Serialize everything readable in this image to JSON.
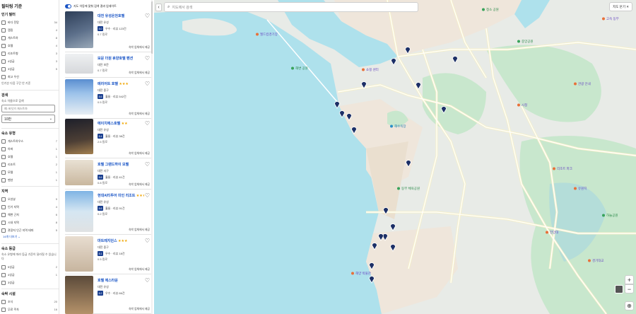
{
  "filters": {
    "title": "필터링 기준",
    "popular": {
      "heading": "인기 필터",
      "items": [
        {
          "label": "바다 전망",
          "count": "34"
        },
        {
          "label": "캠핑",
          "count": "4"
        },
        {
          "label": "게스트하",
          "count": "8"
        },
        {
          "label": "호텔",
          "count": "4"
        },
        {
          "label": "리조트형",
          "count": "3"
        },
        {
          "label": "4성급",
          "count": "3"
        },
        {
          "label": "3성급",
          "count": "5"
        },
        {
          "label": "최고 우선",
          "count": ""
        }
      ],
      "note": "인기순 다음 구간 안 기준"
    },
    "property_name": {
      "heading": "검색",
      "sub": "숙소 이름으로 검색",
      "placeholder": "예: 바닷가 게스트하"
    },
    "sort": {
      "value": "10만",
      "arrow": "⌄"
    },
    "type": {
      "heading": "숙소 유형",
      "items": [
        {
          "label": "게스트하우스",
          "count": "7"
        },
        {
          "label": "아파",
          "count": "1"
        },
        {
          "label": "호텔",
          "count": "1"
        },
        {
          "label": "리조트",
          "count": "2"
        },
        {
          "label": "모텔",
          "count": "1"
        },
        {
          "label": "펜션",
          "count": "1"
        }
      ]
    },
    "area": {
      "heading": "지역",
      "items": [
        {
          "label": "오션뷰",
          "count": "9"
        },
        {
          "label": "인기 지역",
          "count": "4"
        },
        {
          "label": "해변 근처",
          "count": "6"
        },
        {
          "label": "시내 지역",
          "count": "8"
        },
        {
          "label": "관광지 인근 지역 테마",
          "count": "5"
        }
      ],
      "more": "14개 더보기 ⌄"
    },
    "rating": {
      "heading": "숙소 등급",
      "note": "숙소 유형에 따라 등급 기준이 달라질 수 있습니다",
      "items": [
        {
          "label": "5성급",
          "count": "2"
        },
        {
          "label": "4성급",
          "count": "1"
        },
        {
          "label": "3성급",
          "count": ""
        }
      ]
    },
    "amenities": {
      "heading": "숙박 시설",
      "items": [
        {
          "label": "조식",
          "count": "20"
        },
        {
          "label": "무료 주차",
          "count": "16"
        },
        {
          "label": "공용 주방",
          "count": "8"
        }
      ]
    }
  },
  "results": {
    "toggle_label": "지도 이동에 맞춰 검색 결과 업데이트",
    "cards": [
      {
        "name": "대전 유성온천호텔",
        "stars": "",
        "area": "대전 유성",
        "score": "8.0",
        "score_label": "우수 · 리뷰 123건",
        "dist": "0.7 킬로",
        "cta": "숙박 업체에서 제공"
      },
      {
        "name": "보문 더원 휴양호텔 펜션",
        "stars": "",
        "area": "대전 보문",
        "score": "",
        "score_label": "",
        "dist": "0.7 킬로",
        "cta": "숙박 업체에서 제공"
      },
      {
        "name": "메리어트 호텔",
        "stars": "★★★",
        "area": "대전 중구",
        "score": "8.6",
        "score_label": "훌륭 · 리뷰 542건",
        "dist": "0.5 킬로",
        "cta": "숙박 업체에서 제공"
      },
      {
        "name": "에이치에스호텔",
        "stars": "★★",
        "area": "대전 유성",
        "score": "8.4",
        "score_label": "훌륭 · 리뷰 38건",
        "dist": "2.6 킬로",
        "cta": "숙박 업체에서 제공"
      },
      {
        "name": "호텔 그랜드하이 모텔",
        "stars": "",
        "area": "대전 서구",
        "score": "8.6",
        "score_label": "훌륭 · 리뷰 41건",
        "dist": "0.8 킬로",
        "cta": "숙박 업체에서 제공"
      },
      {
        "name": "현대씨티투어 미인 리조트",
        "stars": "★★★",
        "area": "대전 유성",
        "score": "8.6",
        "score_label": "훌륭 · 리뷰 91건",
        "dist": "0.2 킬로",
        "cta": "숙박 업체에서 제공"
      },
      {
        "name": "마트레지던스",
        "stars": "★★★",
        "area": "대전 중구",
        "score": "8.1",
        "score_label": "우수 · 리뷰 18건",
        "dist": "0.5 킬로",
        "cta": "숙박 업체에서 제공"
      },
      {
        "name": "호텔 에스타운",
        "stars": "",
        "area": "대전 유성",
        "score": "8.2",
        "score_label": "우수 · 리뷰 66건",
        "dist": "",
        "cta": "숙박 업체에서 제공"
      }
    ]
  },
  "map": {
    "collapse_label": "‹",
    "search_placeholder": "지도에서 검색",
    "close_label": "지도 닫기 ✕",
    "zoom_in": "+",
    "zoom_out": "−",
    "locate": "⊕",
    "labels": [
      {
        "text": "청소 공원",
        "kind": "park"
      },
      {
        "text": "월드컵경기장",
        "kind": "poi"
      },
      {
        "text": "중앙공원",
        "kind": "park"
      },
      {
        "text": "쇼핑 센터",
        "kind": "poi"
      },
      {
        "text": "해변 공원",
        "kind": "park"
      },
      {
        "text": "해수욕장",
        "kind": "beach"
      },
      {
        "text": "시청",
        "kind": "poi"
      },
      {
        "text": "동부 체육공원",
        "kind": "park"
      },
      {
        "text": "리조트 파크",
        "kind": "poi"
      },
      {
        "text": "전망대",
        "kind": "poi"
      },
      {
        "text": "관광 안내",
        "kind": "poi"
      },
      {
        "text": "유원지",
        "kind": "poi"
      },
      {
        "text": "경기대교",
        "kind": "poi"
      },
      {
        "text": "해양 박물관",
        "kind": "poi"
      },
      {
        "text": "고속 동부",
        "kind": "poi"
      },
      {
        "text": "하늘공원",
        "kind": "park"
      }
    ],
    "colors": {
      "water": "#aee1ec",
      "land": "#e8ebe7",
      "park": "#c8e7cd",
      "urban": "#efe6db",
      "pin": "#1c2f66",
      "poi": "#e8703a"
    }
  }
}
